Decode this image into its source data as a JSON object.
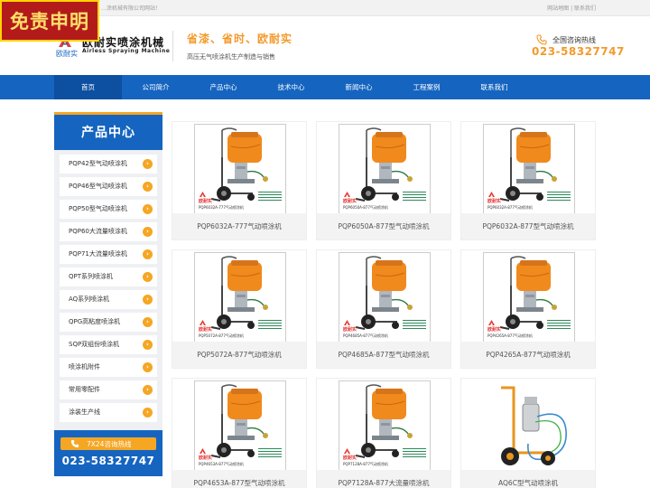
{
  "disclaimer": "免责申明",
  "topbar": {
    "welcome": "…涂机械有限公司网站！",
    "links": "网站地图 | 联系我们"
  },
  "header": {
    "logo_sub": "欧耐实",
    "brand_cn": "欧耐实喷涂机械",
    "brand_en": "Airless Spraying Machine",
    "slogan": "省漆、省时、欧耐实",
    "slogan_sub": "高压无气喷涂机生产制造与销售",
    "hotline_label": "全国咨询热线",
    "hotline_number": "023-58327747"
  },
  "nav": {
    "items": [
      {
        "label": "首页"
      },
      {
        "label": "公司简介"
      },
      {
        "label": "产品中心"
      },
      {
        "label": "技术中心"
      },
      {
        "label": "新闻中心"
      },
      {
        "label": "工程案例"
      },
      {
        "label": "联系我们"
      }
    ]
  },
  "sidebar": {
    "title": "产品中心",
    "items": [
      {
        "label": "PQP42型气动喷涂机"
      },
      {
        "label": "PQP46型气动喷涂机"
      },
      {
        "label": "PQP50型气动喷涂机"
      },
      {
        "label": "PQP60大流量喷涂机"
      },
      {
        "label": "PQP71大流量喷涂机"
      },
      {
        "label": "QPT系列喷涂机"
      },
      {
        "label": "AQ系列喷涂机"
      },
      {
        "label": "QPG高粘度喷涂机"
      },
      {
        "label": "SQP双组份喷涂机"
      },
      {
        "label": "喷涂机附件"
      },
      {
        "label": "常用零配件"
      },
      {
        "label": "涂装生产线"
      }
    ],
    "arrow": "›",
    "hotline_label": "7X24咨询热线",
    "hotline_number": "023-58327747"
  },
  "products": [
    {
      "name": "PQP6032A-777气动喷涂机",
      "plate": "PQP6032A-777气动喷涂机",
      "brand": "欧耐实"
    },
    {
      "name": "PQP6050A-877型气动喷涂机",
      "plate": "PQP6050A-877气动喷涂机",
      "brand": "欧耐实"
    },
    {
      "name": "PQP6032A-877型气动喷涂机",
      "plate": "PQP6032A-877气动喷涂机",
      "brand": "欧耐实"
    },
    {
      "name": "PQP5072A-877气动喷涂机",
      "plate": "PQP5072A-877气动喷涂机",
      "brand": "欧耐实"
    },
    {
      "name": "PQP4685A-877型气动喷涂机",
      "plate": "PQP4685A-877气动喷涂机",
      "brand": "欧耐实"
    },
    {
      "name": "PQP4265A-877气动喷涂机",
      "plate": "PQP4265A-877气动喷涂机",
      "brand": "欧耐实"
    },
    {
      "name": "PQP4653A-877型气动喷涂机",
      "plate": "PQP4653A-877气动喷涂机",
      "brand": "欧耐实"
    },
    {
      "name": "PQP7128A-877大流量喷涂机",
      "plate": "PQP7128A-877气动喷涂机",
      "brand": "欧耐实"
    },
    {
      "name": "AQ6C型气动喷涂机",
      "plate": "",
      "brand": ""
    }
  ],
  "colors": {
    "primary": "#1565c0",
    "accent": "#f5a623",
    "slogan": "#f39a2c",
    "disclaimer_bg": "#b31b1b"
  }
}
